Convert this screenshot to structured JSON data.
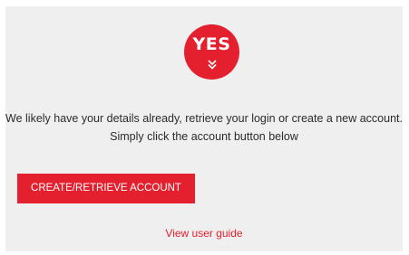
{
  "logo": {
    "text": "YES",
    "icon": "double-chevron-down-icon",
    "color": "#e4202f"
  },
  "message": {
    "line1": "We likely have your details already, retrieve your login or create a new account.",
    "line2": "Simply click the account button below"
  },
  "actions": {
    "create_label": "CREATE/RETRIEVE ACCOUNT",
    "guide_label": "View user guide"
  },
  "colors": {
    "accent": "#e4202f",
    "panel_bg": "#efefef",
    "text": "#2b2b2b"
  }
}
